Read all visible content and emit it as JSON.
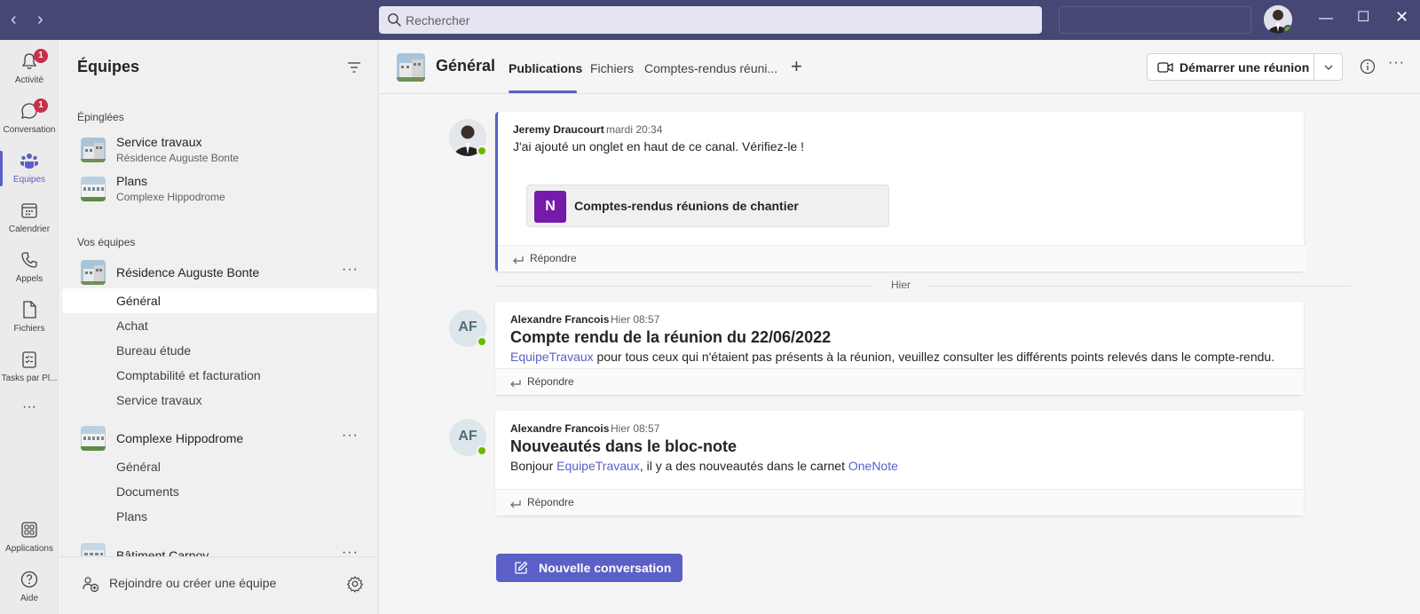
{
  "colors": {
    "titlebar": "#464775",
    "accent": "#5b5fc7",
    "badge": "#c4314b",
    "presence": "#6bb700",
    "onenote": "#7719aa"
  },
  "search": {
    "placeholder": "Rechercher"
  },
  "rail": {
    "items": [
      {
        "label": "Activité",
        "icon": "bell-icon",
        "badge": "1"
      },
      {
        "label": "Conversation",
        "icon": "chat-icon",
        "badge": "1"
      },
      {
        "label": "Équipes",
        "icon": "teams-icon"
      },
      {
        "label": "Calendrier",
        "icon": "calendar-icon"
      },
      {
        "label": "Appels",
        "icon": "phone-icon"
      },
      {
        "label": "Fichiers",
        "icon": "file-icon"
      },
      {
        "label": "Tasks par Pl...",
        "icon": "tasks-icon"
      }
    ],
    "more": "···",
    "bottom": [
      {
        "label": "Applications",
        "icon": "apps-icon"
      },
      {
        "label": "Aide",
        "icon": "help-icon"
      }
    ]
  },
  "panel": {
    "title": "Équipes",
    "pinned_label": "Épinglées",
    "pinned": [
      {
        "name": "Service travaux",
        "sub": "Résidence Auguste Bonte"
      },
      {
        "name": "Plans",
        "sub": "Complexe Hippodrome"
      }
    ],
    "teams_label": "Vos équipes",
    "teams": [
      {
        "name": "Résidence Auguste Bonte",
        "channels": [
          "Général",
          "Achat",
          "Bureau étude",
          "Comptabilité et facturation",
          "Service travaux"
        ]
      },
      {
        "name": "Complexe Hippodrome",
        "channels": [
          "Général",
          "Documents",
          "Plans"
        ]
      },
      {
        "name": "Bâtiment Carnoy",
        "channels": []
      }
    ],
    "more": "···",
    "footer": {
      "join": "Rejoindre ou créer une équipe"
    }
  },
  "channel": {
    "title": "Général",
    "tabs": [
      "Publications",
      "Fichiers",
      "Comptes-rendus réuni..."
    ],
    "add_tab": "+",
    "meet_button": "Démarrer une réunion",
    "more": "···"
  },
  "messages": [
    {
      "author": "Jeremy Draucourt",
      "time": "mardi 20:34",
      "text": "J'ai ajouté un onglet en haut de ce canal. Vérifiez-le !",
      "attachment": {
        "logo": "N",
        "label": "Comptes-rendus réunions de chantier"
      },
      "reply": "Répondre"
    },
    {
      "author": "Alexandre Francois",
      "initials": "AF",
      "time": "Hier 08:57",
      "subject": "Compte rendu de la réunion du 22/06/2022",
      "mention": "EquipeTravaux",
      "text": " pour tous ceux qui n'étaient pas présents à la réunion, veuillez consulter les différents points relevés dans le compte-rendu.",
      "reply": "Répondre"
    },
    {
      "author": "Alexandre Francois",
      "initials": "AF",
      "time": "Hier 08:57",
      "subject": "Nouveautés dans le bloc-note",
      "text_start": "Bonjour ",
      "mention": "EquipeTravaux",
      "text_mid": ", il y a des nouveautés dans le carnet ",
      "link": "OneNote",
      "reply": "Répondre"
    }
  ],
  "divider": "Hier",
  "new_conversation": "Nouvelle conversation"
}
